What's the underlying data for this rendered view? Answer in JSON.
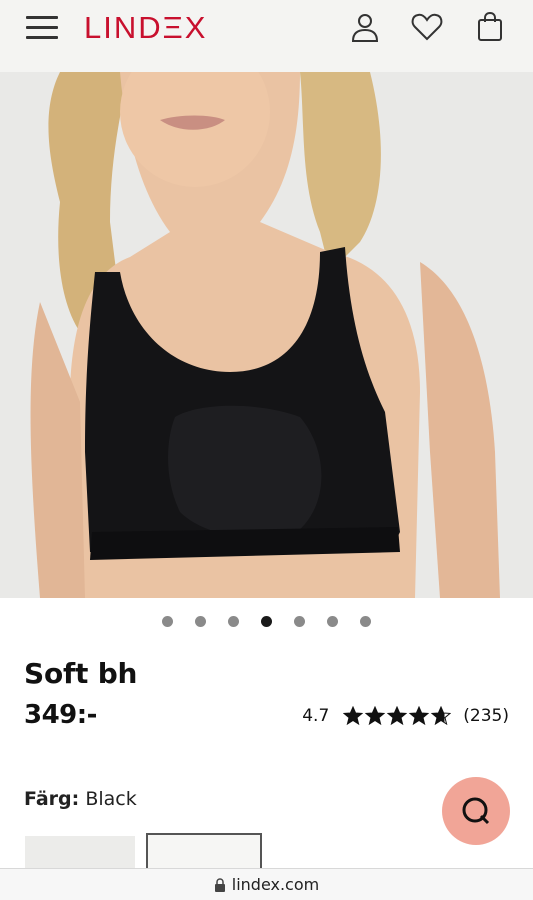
{
  "header": {
    "brand": "LINDΞX",
    "icons": [
      "menu-icon",
      "account-icon",
      "heart-icon",
      "bag-icon"
    ]
  },
  "gallery": {
    "image_count": 7,
    "active_index": 3
  },
  "product": {
    "name": "Soft bh",
    "price": "349:-",
    "rating": "4.7",
    "stars": 4.7,
    "review_count": "(235)",
    "color_label": "Färg:",
    "color_value": "Black"
  },
  "browser": {
    "url": "lindex.com"
  },
  "colors": {
    "brand": "#c8102e",
    "chat": "#f1a597"
  }
}
